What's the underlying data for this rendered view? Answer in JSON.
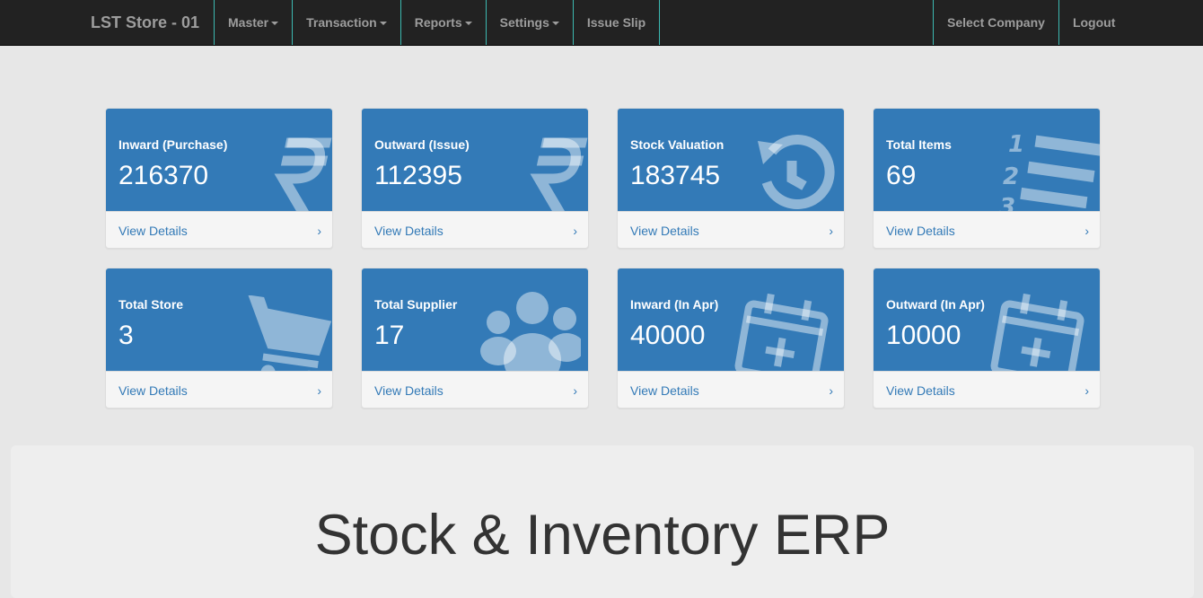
{
  "navbar": {
    "brand": "LST Store - 01",
    "left": [
      "Master",
      "Transaction",
      "Reports",
      "Settings",
      "Issue Slip"
    ],
    "right": [
      "Select Company",
      "Logout"
    ]
  },
  "colors": {
    "panel": "#337ab7",
    "navbar": "#222222",
    "divider": "#3cb9b1"
  },
  "panels": [
    {
      "title": "Inward (Purchase)",
      "value": "216370",
      "link": "View Details",
      "icon": "rupee-icon"
    },
    {
      "title": "Outward (Issue)",
      "value": "112395",
      "link": "View Details",
      "icon": "rupee-icon"
    },
    {
      "title": "Stock Valuation",
      "value": "183745",
      "link": "View Details",
      "icon": "history-icon"
    },
    {
      "title": "Total Items",
      "value": "69",
      "link": "View Details",
      "icon": "ordered-list-icon"
    },
    {
      "title": "Total Store",
      "value": "3",
      "link": "View Details",
      "icon": "shopping-cart-icon"
    },
    {
      "title": "Total Supplier",
      "value": "17",
      "link": "View Details",
      "icon": "users-icon"
    },
    {
      "title": "Inward (In Apr)",
      "value": "40000",
      "link": "View Details",
      "icon": "calendar-plus-icon"
    },
    {
      "title": "Outward (In Apr)",
      "value": "10000",
      "link": "View Details",
      "icon": "calendar-plus-icon"
    }
  ],
  "jumbotron": {
    "title": "Stock & Inventory ERP"
  }
}
